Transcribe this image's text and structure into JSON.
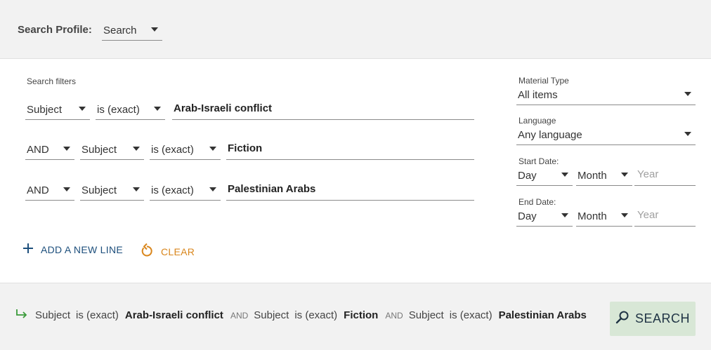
{
  "profile": {
    "label": "Search Profile:",
    "value": "Search"
  },
  "filters": {
    "heading": "Search filters",
    "rows": [
      {
        "field": "Subject",
        "operator": "is (exact)",
        "term": "Arab-Israeli conflict"
      },
      {
        "conjunction": "AND",
        "field": "Subject",
        "operator": "is (exact)",
        "term": "Fiction"
      },
      {
        "conjunction": "AND",
        "field": "Subject",
        "operator": "is (exact)",
        "term": "Palestinian Arabs"
      }
    ],
    "add_line_label": "ADD A NEW LINE",
    "clear_label": "CLEAR"
  },
  "facets": {
    "material_type": {
      "label": "Material Type",
      "value": "All items"
    },
    "language": {
      "label": "Language",
      "value": "Any language"
    },
    "start_date": {
      "label": "Start Date:",
      "day": "Day",
      "month": "Month",
      "year_placeholder": "Year"
    },
    "end_date": {
      "label": "End Date:",
      "day": "Day",
      "month": "Month",
      "year_placeholder": "Year"
    }
  },
  "summary": {
    "conjunction": "AND",
    "items": [
      {
        "field": "Subject",
        "operator": "is (exact)",
        "term": "Arab-Israeli conflict"
      },
      {
        "field": "Subject",
        "operator": "is (exact)",
        "term": "Fiction"
      },
      {
        "field": "Subject",
        "operator": "is (exact)",
        "term": "Palestinian Arabs"
      }
    ]
  },
  "search_button": {
    "label": "SEARCH"
  },
  "icons": {
    "add": "plus-icon",
    "clear": "refresh-icon",
    "summary": "arrow-return-icon",
    "search": "magnifier-icon"
  },
  "colors": {
    "primary": "#1d4f7c",
    "clear": "#d9861c",
    "search_button_bg": "#d8e7d6",
    "summary_arrow": "#3a9a3a"
  }
}
